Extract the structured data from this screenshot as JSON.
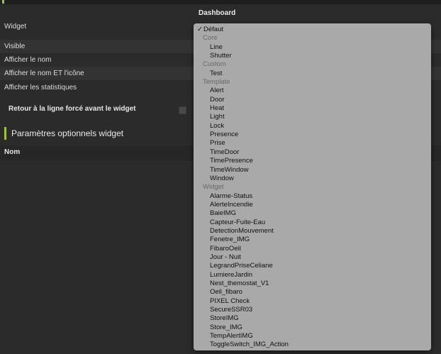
{
  "header": {
    "title": "Dashboard"
  },
  "fields": {
    "widget_label": "Widget",
    "visible": "Visible",
    "afficher_nom": "Afficher le nom",
    "afficher_nom_icone": "Afficher le nom ET l'icône",
    "afficher_stats": "Afficher les statistiques",
    "retour_ligne": "Retour à la ligne forcé avant le widget"
  },
  "section": {
    "title": "Paramètres optionnels widget"
  },
  "table": {
    "col_nom": "Nom"
  },
  "dropdown": {
    "selected": "Défaut",
    "check_glyph": "✓",
    "options": [
      {
        "type": "selected",
        "label": "Défaut"
      },
      {
        "type": "group",
        "label": "Core"
      },
      {
        "type": "item",
        "label": "Line"
      },
      {
        "type": "item",
        "label": "Shutter"
      },
      {
        "type": "group",
        "label": "Custom"
      },
      {
        "type": "item",
        "label": "Test"
      },
      {
        "type": "group",
        "label": "Template"
      },
      {
        "type": "item",
        "label": "Alert"
      },
      {
        "type": "item",
        "label": "Door"
      },
      {
        "type": "item",
        "label": "Heat"
      },
      {
        "type": "item",
        "label": "Light"
      },
      {
        "type": "item",
        "label": "Lock"
      },
      {
        "type": "item",
        "label": "Presence"
      },
      {
        "type": "item",
        "label": "Prise"
      },
      {
        "type": "item",
        "label": "TimeDoor"
      },
      {
        "type": "item",
        "label": "TimePresence"
      },
      {
        "type": "item",
        "label": "TimeWindow"
      },
      {
        "type": "item",
        "label": "Window"
      },
      {
        "type": "group",
        "label": "Widget"
      },
      {
        "type": "item",
        "label": "Alarme-Status"
      },
      {
        "type": "item",
        "label": "AlerteIncendie"
      },
      {
        "type": "item",
        "label": "BaieIMG"
      },
      {
        "type": "item",
        "label": "Capteur-Fuite-Eau"
      },
      {
        "type": "item",
        "label": "DetectionMouvement"
      },
      {
        "type": "item",
        "label": "Fenetre_IMG"
      },
      {
        "type": "item",
        "label": "FibaroOeil"
      },
      {
        "type": "item",
        "label": "Jour - Nuit"
      },
      {
        "type": "item",
        "label": "LegrandPriseCeliane"
      },
      {
        "type": "item",
        "label": "LumiereJardin"
      },
      {
        "type": "item",
        "label": "Nest_themostat_V1"
      },
      {
        "type": "item",
        "label": "Oeil_fibaro"
      },
      {
        "type": "item",
        "label": "PIXEL Check"
      },
      {
        "type": "item",
        "label": "SecureSSR03"
      },
      {
        "type": "item",
        "label": "StoreIMG"
      },
      {
        "type": "item",
        "label": "Store_IMG"
      },
      {
        "type": "item",
        "label": "TempAlertIMG"
      },
      {
        "type": "item",
        "label": "ToggleSwitch_IMG_Action"
      }
    ]
  }
}
